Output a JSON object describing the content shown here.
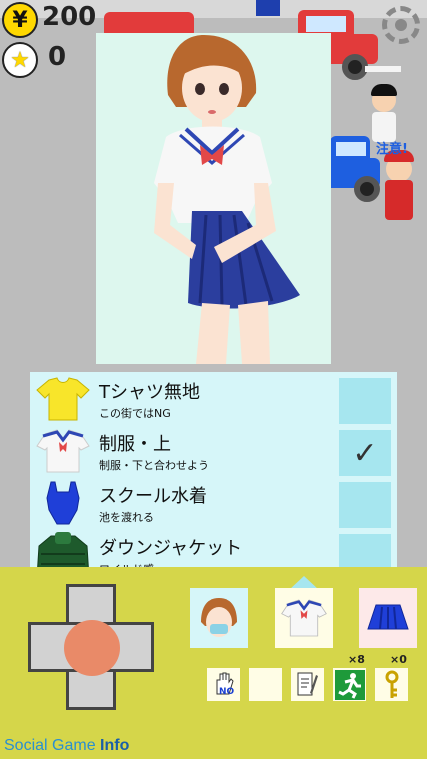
{
  "hud": {
    "money_symbol": "¥",
    "money": "200",
    "stars": "0"
  },
  "npc": {
    "alert_text": "注意!"
  },
  "items": [
    {
      "name": "Tシャツ無地",
      "desc": "この街ではNG",
      "checked": false
    },
    {
      "name": "制服・上",
      "desc": "制服・下と合わせよう",
      "checked": true,
      "check_glyph": "✓"
    },
    {
      "name": "スクール水着",
      "desc": "池を渡れる",
      "checked": false
    },
    {
      "name": "ダウンジャケット",
      "desc": "ワイルド感",
      "checked": false
    }
  ],
  "actions": {
    "no_label": "NO",
    "run_count": "×8",
    "key_count": "×0"
  },
  "watermark": {
    "part1": "Social Game",
    "part2": "Info"
  },
  "colors": {
    "field": "#bcbcbc",
    "controls_bg": "#d5d64a",
    "list_bg": "#d6f6f9",
    "check_bg": "#a6e6ef",
    "coin": "#ffd800",
    "preview_bg": "#ddf7ee"
  }
}
